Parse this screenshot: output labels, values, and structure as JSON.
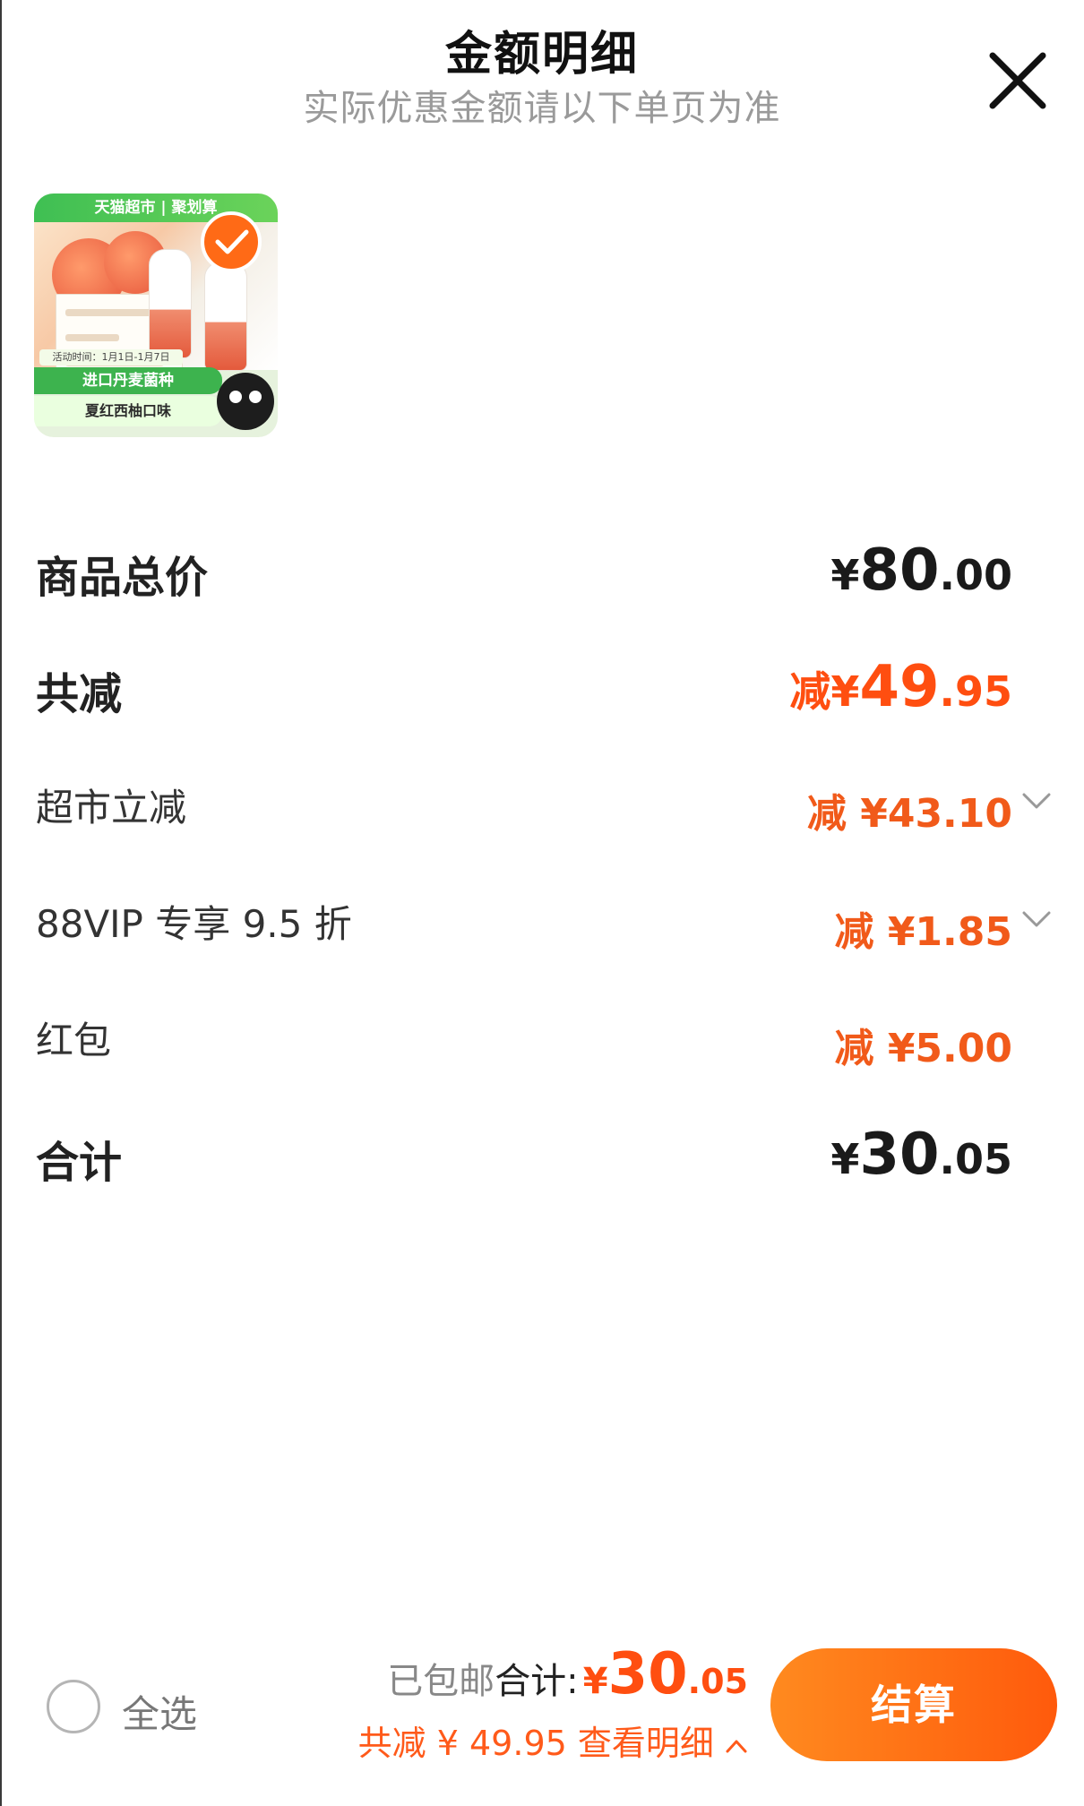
{
  "header": {
    "title": "金额明细",
    "subtitle": "实际优惠金额请以下单页为准"
  },
  "product": {
    "top_banner": "天猫超市 | 聚划算",
    "date_strip": "活动时间：1月1日-1月7日",
    "label_green": "进口丹麦菌种",
    "label_white": "夏红西柚口味",
    "selected": true
  },
  "rows": {
    "total_price": {
      "label": "商品总价",
      "yen": "¥",
      "int": "80",
      "dec": ".00"
    },
    "total_discount": {
      "label": "共减",
      "prefix": "减",
      "yen": "¥",
      "int": "49",
      "dec": ".95"
    },
    "market_discount": {
      "label": "超市立减",
      "value": "减 ¥43.10"
    },
    "vip_discount": {
      "label": "88VIP 专享 9.5 折",
      "value": "减 ¥1.85"
    },
    "red_packet": {
      "label": "红包",
      "value": "减 ¥5.00"
    },
    "sum": {
      "label": "合计",
      "yen": "¥",
      "int": "30",
      "dec": ".05"
    }
  },
  "bottom_bar": {
    "select_all": "全选",
    "shipping": "已包邮",
    "total_label": "合计:",
    "yen": "¥",
    "amount_int": "30",
    "amount_dec": ".05",
    "saved_text": "共减 ¥ 49.95",
    "details_link": "查看明细",
    "checkout": "结算"
  },
  "colors": {
    "accent": "#ff4e10",
    "checkout_gradient_start": "#ff8a1f",
    "checkout_gradient_end": "#ff5a0c"
  },
  "icons": [
    "close-icon",
    "check-icon",
    "chevron-down-icon",
    "chevron-up-icon",
    "radio-empty-icon"
  ]
}
